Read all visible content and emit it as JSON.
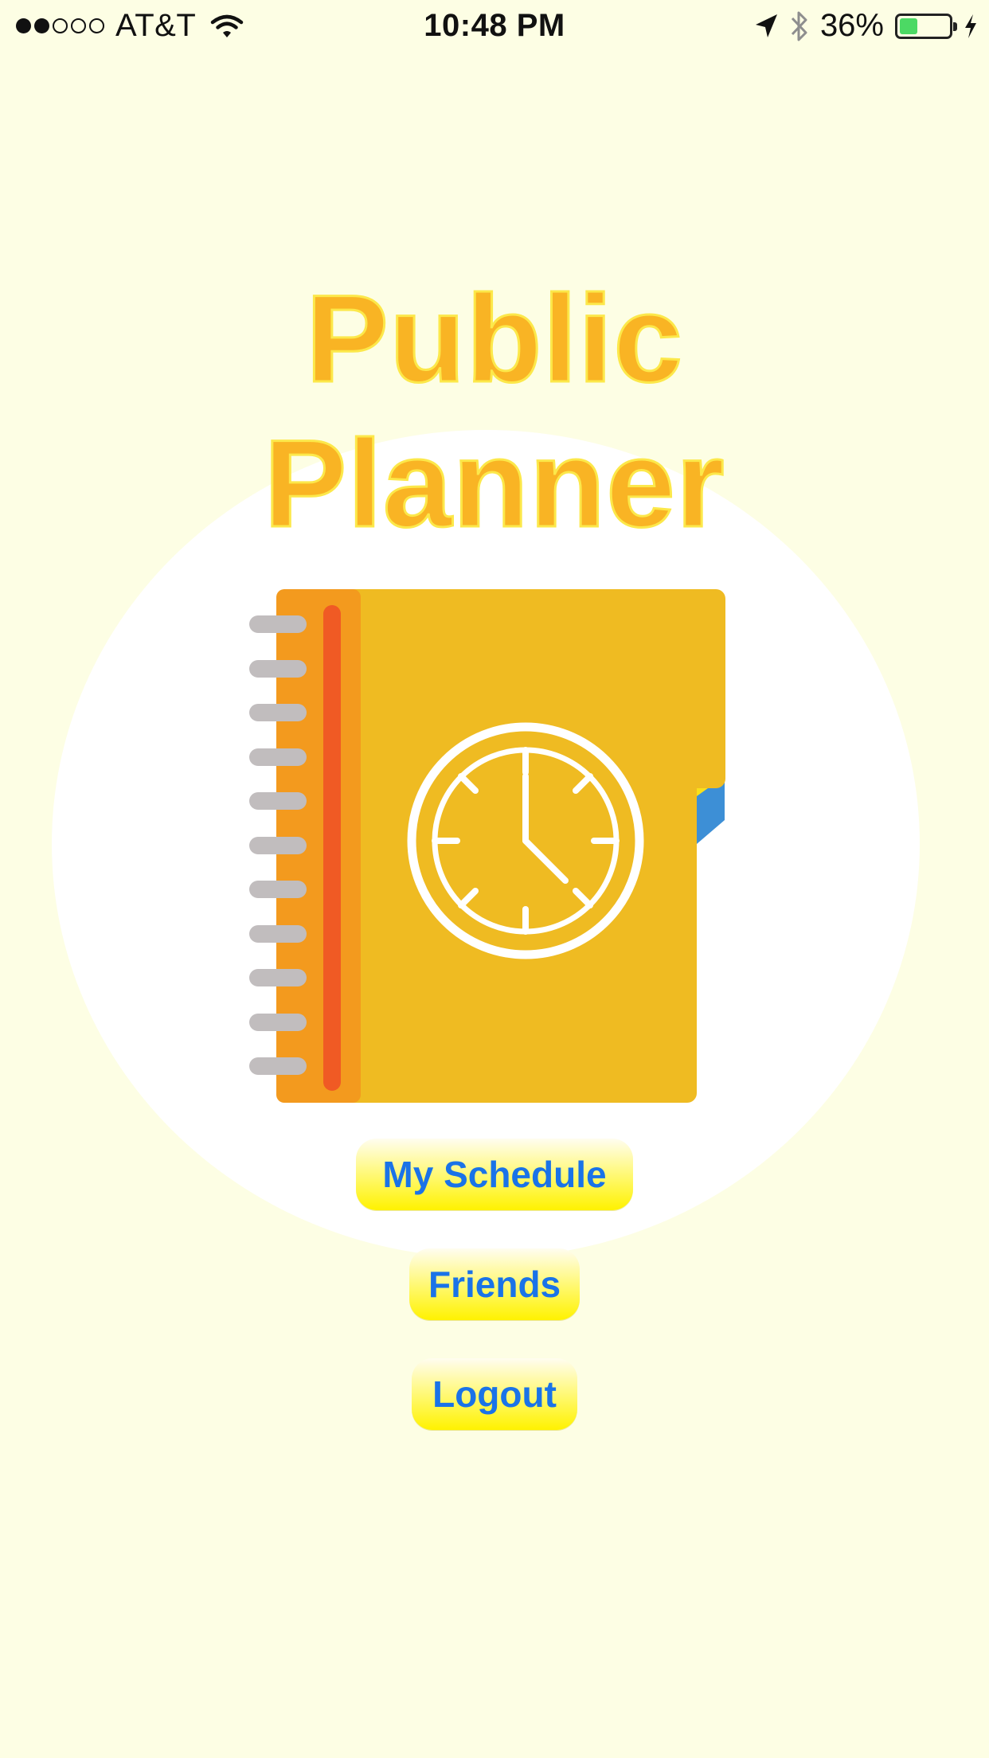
{
  "status_bar": {
    "signal": {
      "filled": 2,
      "total": 5
    },
    "carrier": "AT&T",
    "time": "10:48 PM",
    "battery_percent_label": "36%",
    "battery_level": 0.36,
    "icons": [
      "wifi-icon",
      "location-arrow-icon",
      "bluetooth-icon",
      "battery-icon",
      "charging-bolt-icon"
    ]
  },
  "app": {
    "title": "Public Planner"
  },
  "menu": {
    "my_schedule_label": "My Schedule",
    "friends_label": "Friends",
    "logout_label": "Logout"
  },
  "colors": {
    "background": "#FDFEE4",
    "title": "#F9B424",
    "button_text": "#1A73E8",
    "button_fill": "#FFF200",
    "planner_cover": "#EFBB22",
    "planner_spine": "#F39A1E",
    "planner_band": "#F05A24"
  }
}
